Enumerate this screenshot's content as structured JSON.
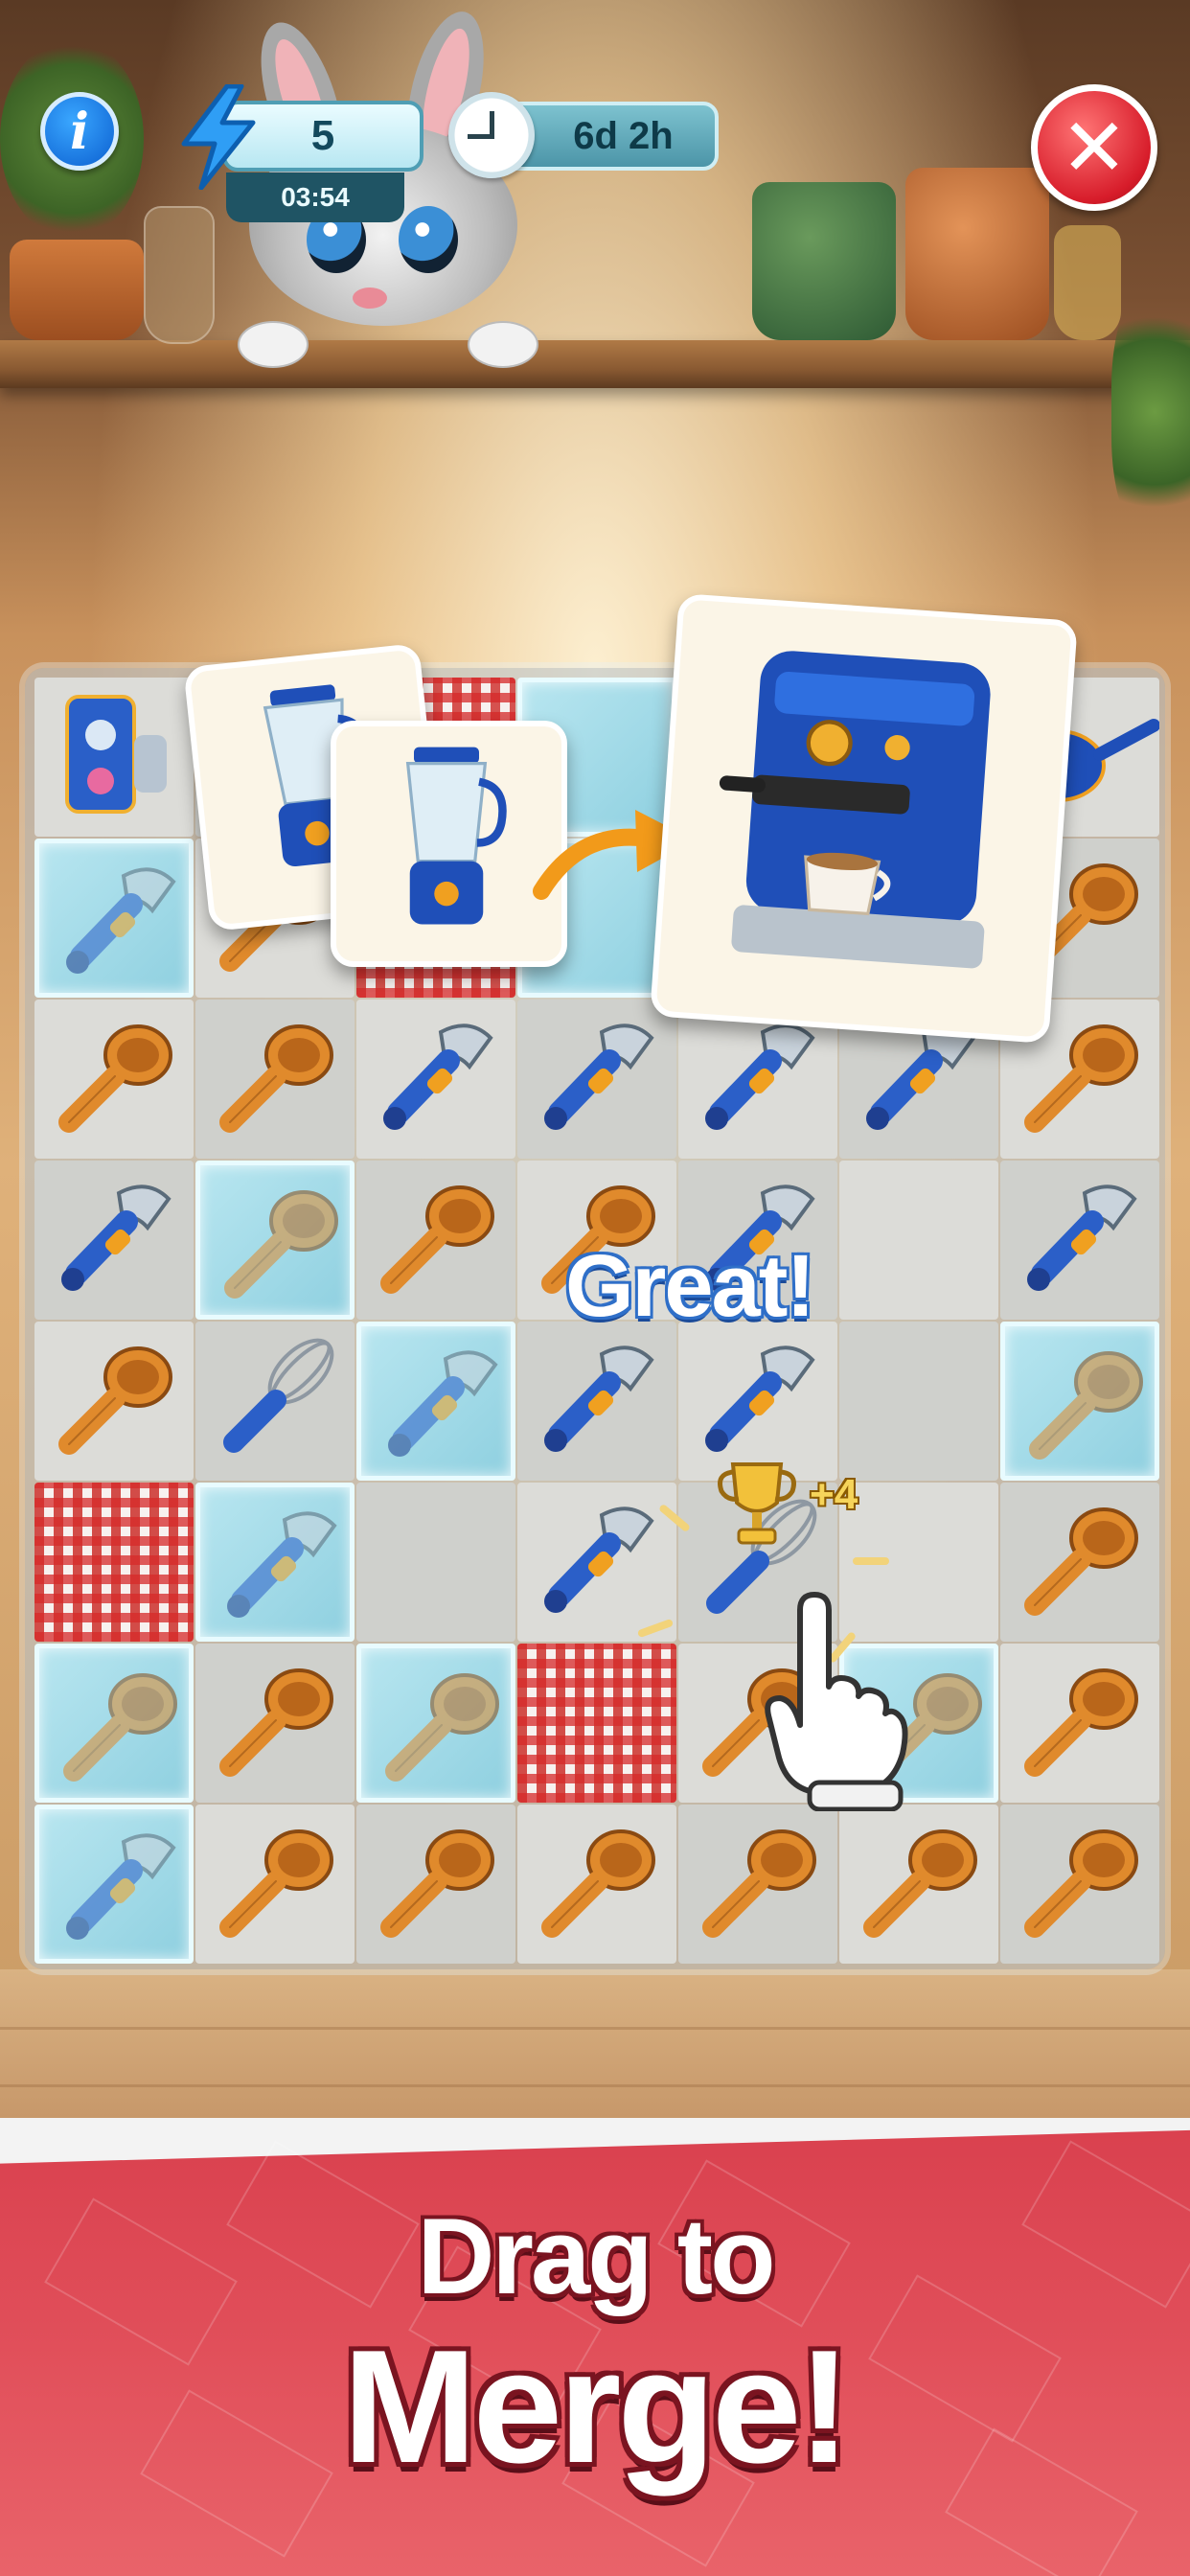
{
  "hud": {
    "info_glyph": "i",
    "energy_value": "5",
    "energy_timer": "03:54",
    "event_time": "6d 2h",
    "close_glyph": "✕"
  },
  "board": {
    "rows": [
      [
        "coffee-maker-set",
        "blender",
        "cloth",
        "locked-empty",
        "coffee-machine",
        "coffee-machine",
        "saucepan"
      ],
      [
        "locked-peeler",
        "spoon",
        "cloth",
        "locked-empty",
        "coffee-machine",
        "coffee-machine",
        "spoon"
      ],
      [
        "spoon",
        "spoon",
        "peeler",
        "peeler",
        "peeler",
        "peeler",
        "spoon"
      ],
      [
        "peeler",
        "locked-spoon",
        "spoon",
        "spoon",
        "peeler",
        "empty",
        "peeler"
      ],
      [
        "spoon",
        "whisk",
        "locked-peeler",
        "peeler",
        "peeler",
        "empty",
        "locked-spoon"
      ],
      [
        "cloth",
        "locked-peeler",
        "empty",
        "peeler",
        "whisk",
        "empty",
        "spoon"
      ],
      [
        "locked-spoon",
        "spoon",
        "locked-spoon",
        "cloth",
        "spoon",
        "locked-spoon",
        "spoon"
      ],
      [
        "locked-peeler",
        "spoon",
        "spoon",
        "spoon",
        "spoon",
        "spoon",
        "spoon"
      ]
    ]
  },
  "merge_popup": {
    "from_item": "blender",
    "to_item": "coffee-machine"
  },
  "feedback": {
    "message": "Great!",
    "bonus": "+4",
    "reward_icon": "trophy-icon"
  },
  "banner": {
    "line1": "Drag to",
    "line2": "Merge!"
  },
  "colors": {
    "banner_red": "#d9404e",
    "energy_teal": "#1f5464",
    "close_red": "#d71c2a",
    "info_blue": "#0b5fd0"
  }
}
